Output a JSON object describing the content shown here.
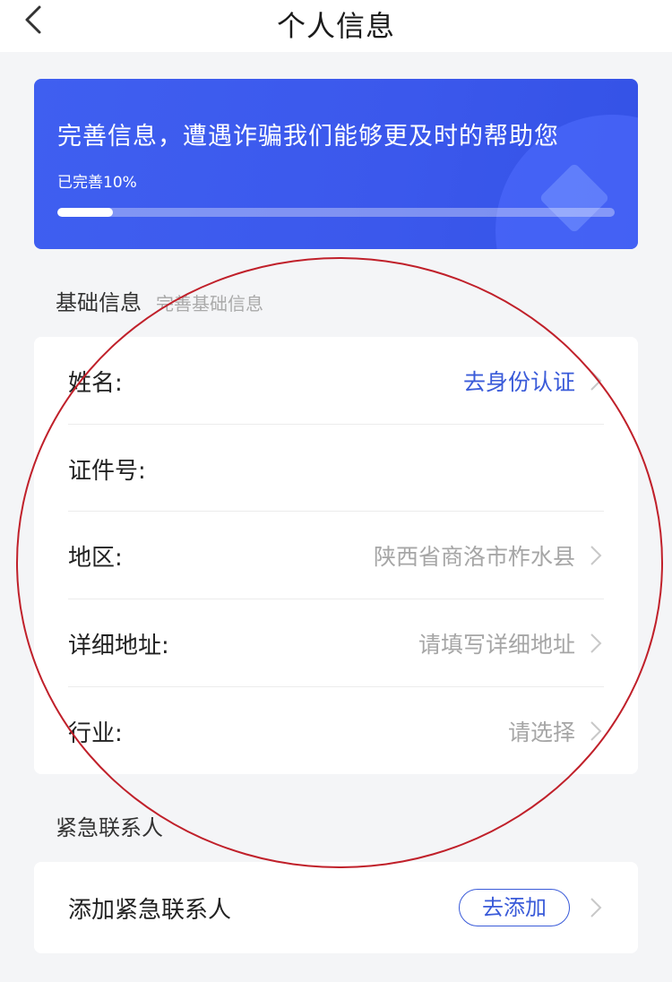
{
  "header": {
    "title": "个人信息"
  },
  "banner": {
    "title": "完善信息，遭遇诈骗我们能够更及时的帮助您",
    "progress_text": "已完善10%",
    "progress": 0.1
  },
  "basic_section": {
    "title": "基础信息",
    "subtitle": "完善基础信息",
    "rows": [
      {
        "label": "姓名:",
        "value": "去身份认证"
      },
      {
        "label": "证件号:",
        "value": ""
      },
      {
        "label": "地区:",
        "value": "陕西省商洛市柞水县"
      },
      {
        "label": "详细地址:",
        "value": "请填写详细地址"
      },
      {
        "label": "行业:",
        "value": "请选择"
      }
    ]
  },
  "emergency_section": {
    "title": "紧急联系人",
    "row_label": "添加紧急联系人",
    "button_label": "去添加"
  },
  "colors": {
    "banner": "#3f5ff0",
    "accent": "#3a5bd9",
    "annotation_circle": "#c0202a"
  }
}
